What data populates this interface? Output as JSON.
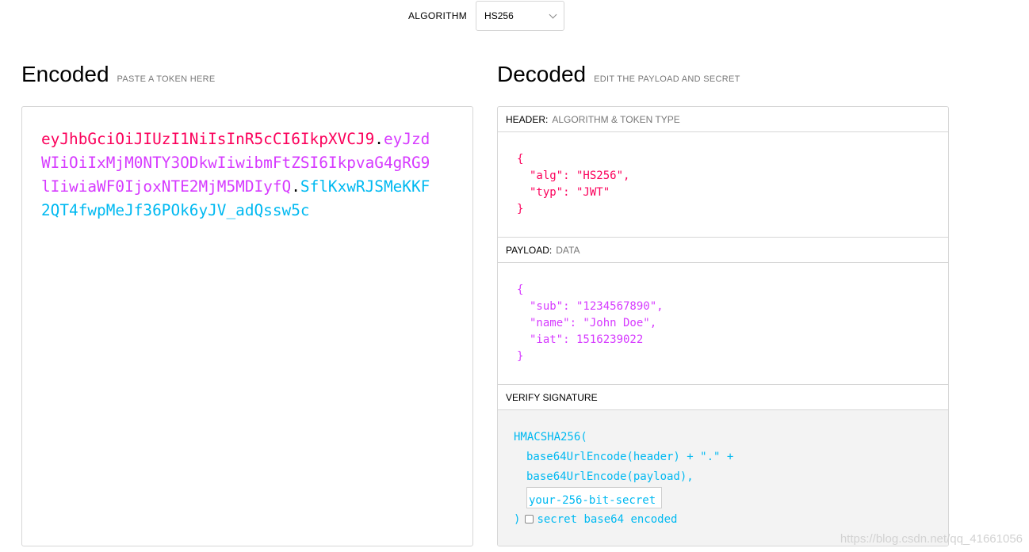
{
  "algorithm": {
    "label": "ALGORITHM",
    "selected": "HS256"
  },
  "encoded": {
    "title": "Encoded",
    "subtitle": "PASTE A TOKEN HERE",
    "token_header": "eyJhbGciOiJIUzI1NiIsInR5cCI6IkpXVCJ9",
    "token_payload": "eyJzdWIiOiIxMjM0NTY3ODkwIiwibmFtZSI6IkpvaG4gRG9lIiwiaWF0IjoxNTE2MjM5MDIyfQ",
    "token_signature": "SflKxwRJSMeKKF2QT4fwpMeJf36POk6yJV_adQssw5c",
    "dot": ".",
    "colors": {
      "header": "#fb015b",
      "payload": "#d63aff",
      "signature": "#00b9f1"
    }
  },
  "decoded": {
    "title": "Decoded",
    "subtitle": "EDIT THE PAYLOAD AND SECRET",
    "header": {
      "label": "HEADER:",
      "desc": "ALGORITHM & TOKEN TYPE",
      "lines": [
        "{",
        "\"alg\": \"HS256\",",
        "\"typ\": \"JWT\"",
        "}"
      ]
    },
    "payload": {
      "label": "PAYLOAD:",
      "desc": "DATA",
      "lines": [
        "{",
        "\"sub\": \"1234567890\",",
        "\"name\": \"John Doe\",",
        "\"iat\": 1516239022",
        "}"
      ]
    },
    "verify": {
      "label": "VERIFY SIGNATURE",
      "fn_open": "HMACSHA256(",
      "line1": "base64UrlEncode(header) + \".\" +",
      "line2": "base64UrlEncode(payload),",
      "secret_placeholder": "your-256-bit-secret",
      "close": ")",
      "checkbox_label": "secret base64 encoded"
    }
  },
  "watermark": "https://blog.csdn.net/qq_41661056"
}
